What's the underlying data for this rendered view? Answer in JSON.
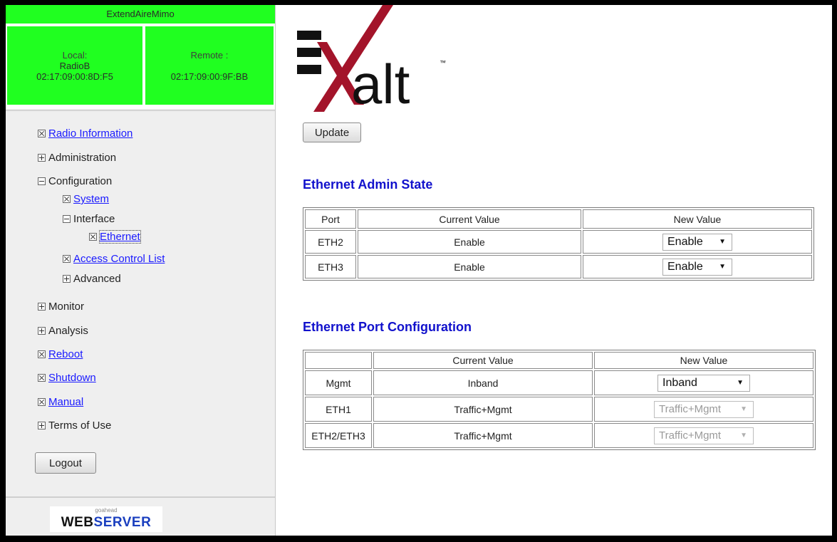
{
  "app": {
    "title": "ExtendAireMimo",
    "local": {
      "label": "Local:",
      "name": "RadioB",
      "mac": "02:17:09:00:8D:F5"
    },
    "remote": {
      "label": "Remote :",
      "mac": "02:17:09:00:9F:BB"
    }
  },
  "nav": {
    "radio_information": "Radio Information",
    "administration": "Administration",
    "configuration": "Configuration",
    "system": "System",
    "interface": "Interface",
    "ethernet": "Ethernet",
    "access_control_list": "Access Control List",
    "advanced": "Advanced",
    "monitor": "Monitor",
    "analysis": "Analysis",
    "reboot": "Reboot",
    "shutdown": "Shutdown",
    "manual": "Manual",
    "terms_of_use": "Terms of Use"
  },
  "logout_label": "Logout",
  "footer": {
    "small": "goahead",
    "big1": "WEB",
    "big2": "SERVER"
  },
  "brand": {
    "text": "alt",
    "tm": "™"
  },
  "update_label": "Update",
  "admin_state": {
    "title": "Ethernet Admin State",
    "headers": [
      "Port",
      "Current Value",
      "New Value"
    ],
    "rows": [
      {
        "port": "ETH2",
        "current": "Enable",
        "new": "Enable"
      },
      {
        "port": "ETH3",
        "current": "Enable",
        "new": "Enable"
      }
    ]
  },
  "port_config": {
    "title": "Ethernet Port Configuration",
    "headers": [
      "",
      "Current Value",
      "New Value"
    ],
    "rows": [
      {
        "port": "Mgmt",
        "current": "Inband",
        "new": "Inband",
        "disabled": false
      },
      {
        "port": "ETH1",
        "current": "Traffic+Mgmt",
        "new": "Traffic+Mgmt",
        "disabled": true
      },
      {
        "port": "ETH2/ETH3",
        "current": "Traffic+Mgmt",
        "new": "Traffic+Mgmt",
        "disabled": true
      }
    ]
  },
  "colors": {
    "header_green": "#20ff20",
    "link_blue": "#1a1aff",
    "section_blue": "#1111cc",
    "brand_red": "#a3142a"
  }
}
